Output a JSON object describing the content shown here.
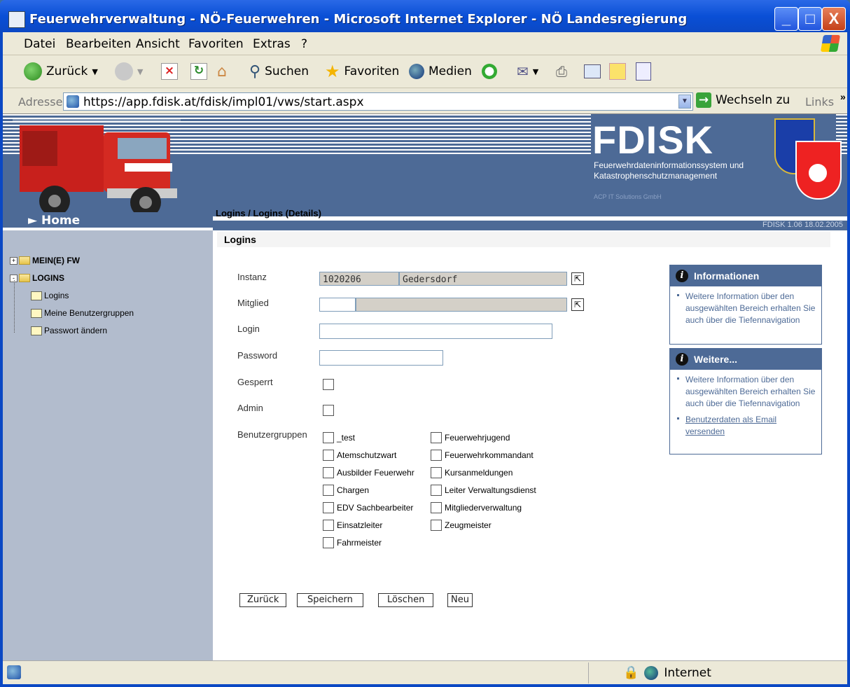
{
  "window": {
    "title": "Feuerwehrverwaltung - NÖ-Feuerwehren - Microsoft Internet Explorer - NÖ Landesregierung",
    "minimize": "_",
    "maximize": "□",
    "close": "X"
  },
  "menu": {
    "items": [
      "Datei",
      "Bearbeiten",
      "Ansicht",
      "Favoriten",
      "Extras",
      "?"
    ]
  },
  "toolbar": {
    "back": "Zurück",
    "search": "Suchen",
    "favorites": "Favoriten",
    "media": "Medien"
  },
  "address": {
    "label": "Adresse",
    "url": "https://app.fdisk.at/fdisk/impl01/vws/start.aspx",
    "go": "Wechseln zu",
    "links": "Links",
    "chevron": "»"
  },
  "header": {
    "logo": "FDISK",
    "subtitle_line1": "Feuerwehrdateninformationssystem und",
    "subtitle_line2": "Katastrophenschutzmanagement",
    "company": "ACP IT Solutions GmbH",
    "home": "Home",
    "breadcrumb": "Logins / Logins (Details)",
    "version": "FDISK 1.06 18.02.2005"
  },
  "sidebar": {
    "nodes": [
      {
        "label": "MEIN(E) FW",
        "toggle": "+"
      },
      {
        "label": "LOGINS",
        "toggle": "-"
      }
    ],
    "children": [
      "Logins",
      "Meine Benutzergruppen",
      "Passwort ändern"
    ]
  },
  "form": {
    "title": "Logins",
    "instanz_label": "Instanz",
    "instanz_code": "1020206",
    "instanz_name": "Gedersdorf",
    "mitglied_label": "Mitglied",
    "mitglied_value": "",
    "login_label": "Login",
    "login_value": "",
    "password_label": "Password",
    "password_value": "",
    "gesperrt_label": "Gesperrt",
    "admin_label": "Admin",
    "groups_label": "Benutzergruppen",
    "groups_col1": [
      "_test",
      "Atemschutzwart",
      "Ausbilder Feuerwehr",
      "Chargen",
      "EDV Sachbearbeiter",
      "Einsatzleiter",
      "Fahrmeister"
    ],
    "groups_col2": [
      "Feuerwehrjugend",
      "Feuerwehrkommandant",
      "Kursanmeldungen",
      "Leiter Verwaltungsdienst",
      "Mitgliederverwaltung",
      "Zeugmeister"
    ],
    "buttons": {
      "back": "Zurück",
      "save": "Speichern",
      "delete": "Löschen",
      "new": "Neu"
    }
  },
  "info": {
    "box1_title": "Informationen",
    "box1_text": "Weitere Information über den ausgewählten Bereich erhalten Sie auch über die Tiefennavigation",
    "box2_title": "Weitere...",
    "box2_text": "Weitere Information über den ausgewählten Bereich erhalten Sie auch über die Tiefennavigation",
    "box2_link": "Benutzerdaten als Email versenden"
  },
  "status": {
    "zone": "Internet"
  }
}
